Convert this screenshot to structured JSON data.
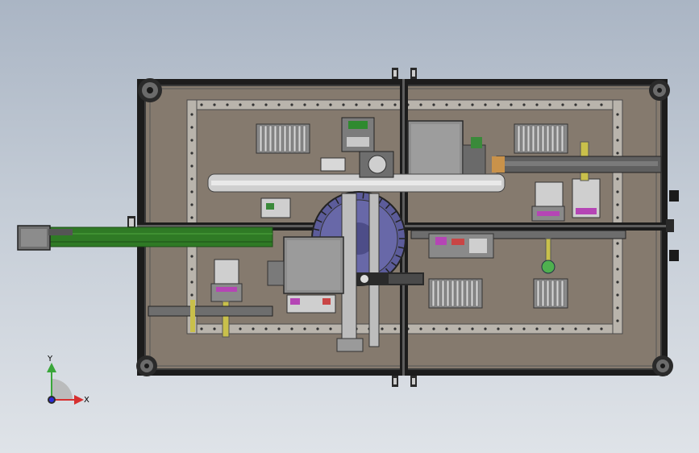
{
  "viewport": {
    "background_top": "#aab5c4",
    "background_bottom": "#dfe3e8",
    "frame_color": "#1c1c1c",
    "plate_color": "#857a6e",
    "conveyor_color": "#2f7a25",
    "dial_color": "#5c5c9a"
  },
  "model_parts": [
    "frame",
    "base-plate",
    "rail-frame",
    "conveyor-belt",
    "feeder-bin",
    "rotary-dial",
    "cylinder-block",
    "motor-unit",
    "heat-sink",
    "casters",
    "cable-chain",
    "sensor-pin"
  ],
  "triad": {
    "x_label": "X",
    "y_label": "Y",
    "x_color": "#d63030",
    "y_color": "#3aa63a",
    "z_color": "#2b2bd9"
  }
}
